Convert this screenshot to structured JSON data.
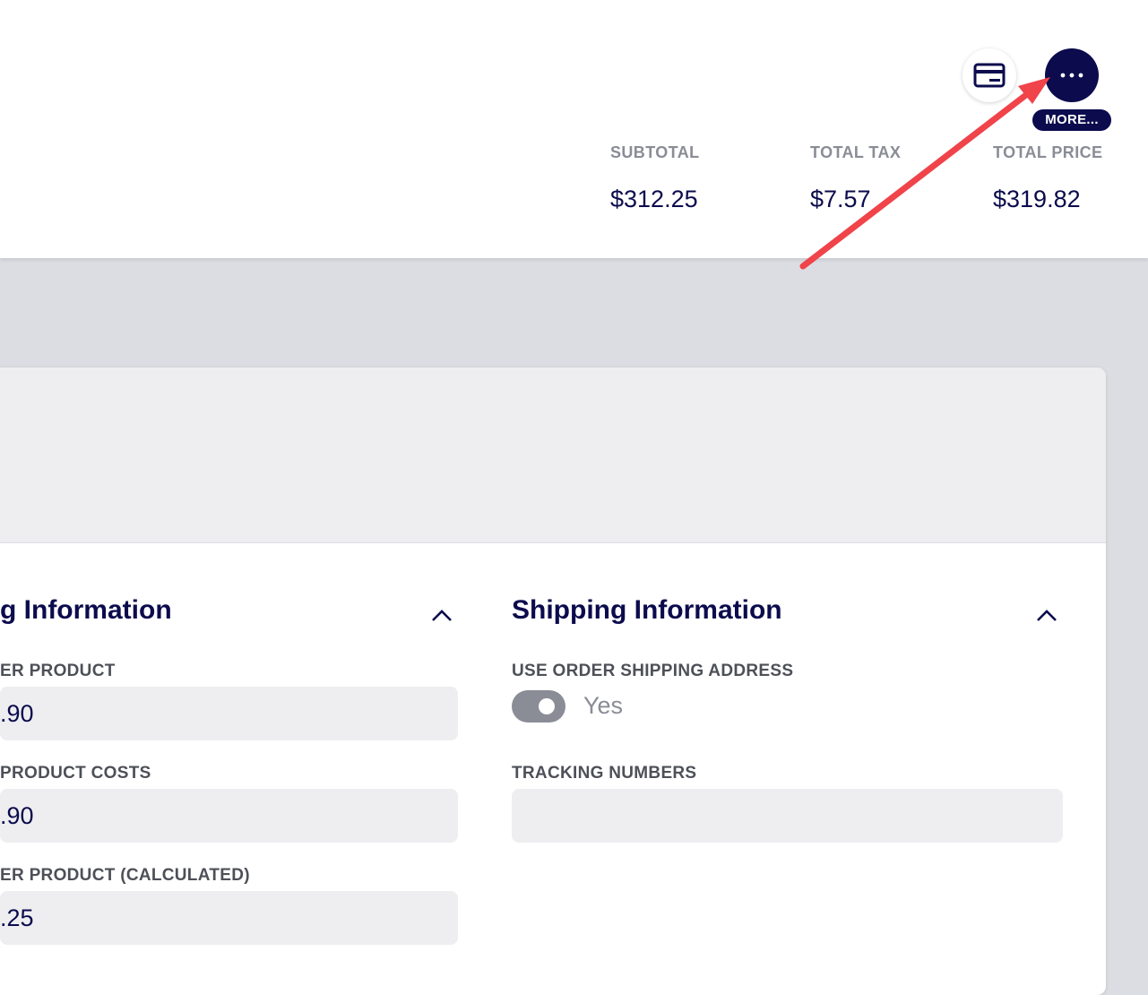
{
  "header": {
    "more_label": "MORE...",
    "totals": [
      {
        "label": "SUBTOTAL",
        "value": "$312.25"
      },
      {
        "label": "TOTAL TAX",
        "value": "$7.57"
      },
      {
        "label": "TOTAL PRICE",
        "value": "$319.82"
      }
    ],
    "icons": {
      "card": "credit-card-icon",
      "more": "ellipsis-icon"
    }
  },
  "billing": {
    "title": "g Information",
    "fields": [
      {
        "label": "ER PRODUCT",
        "value": ".90"
      },
      {
        "label": "PRODUCT COSTS",
        "value": ".90"
      },
      {
        "label": "ER PRODUCT (CALCULATED)",
        "value": ".25"
      }
    ]
  },
  "shipping": {
    "title": "Shipping Information",
    "use_order_address": {
      "label": "USE ORDER SHIPPING ADDRESS",
      "value": "Yes",
      "on": true
    },
    "tracking": {
      "label": "TRACKING NUMBERS",
      "value": ""
    }
  },
  "colors": {
    "navy": "#0b0b4d",
    "annotation_arrow": "#f0434a",
    "muted": "#8a8c96"
  }
}
